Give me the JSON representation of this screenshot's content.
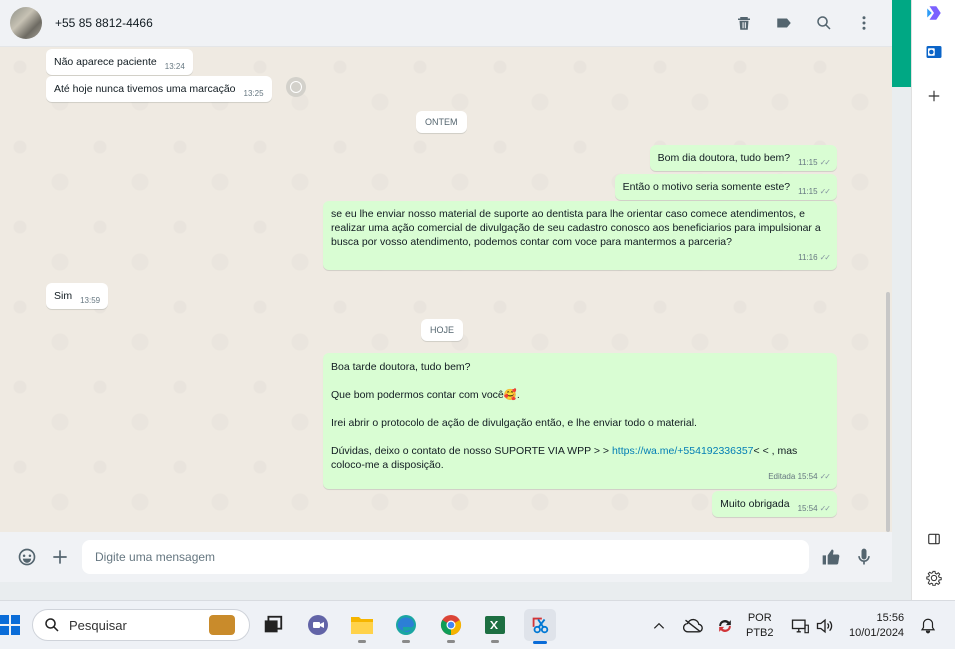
{
  "header": {
    "contact_name": "+55 85 8812-4466",
    "icons": [
      "delete-icon",
      "label-icon",
      "search-icon",
      "menu-icon"
    ]
  },
  "messages": [
    {
      "dir": "in",
      "text": "Não aparece paciente",
      "time": "13:24"
    },
    {
      "dir": "in",
      "text": "Até hoje nunca tivemos uma marcação",
      "time": "13:25"
    },
    {
      "dir": "date",
      "text": "ONTEM"
    },
    {
      "dir": "out",
      "text": "Bom dia doutora, tudo bem?",
      "time": "11:15"
    },
    {
      "dir": "out",
      "text": "Então o motivo seria somente este?",
      "time": "11:15"
    },
    {
      "dir": "out",
      "text": "se eu lhe enviar nosso material de suporte ao dentista para lhe orientar caso comece atendimentos, e realizar uma ação comercial de divulgação de seu cadastro conosco aos beneficiarios para impulsionar a busca por vosso atendimento, podemos contar com voce para mantermos a parceria?",
      "time": "11:16"
    },
    {
      "dir": "in",
      "text": "Sim",
      "time": "13:59"
    },
    {
      "dir": "date",
      "text": "HOJE"
    },
    {
      "dir": "out",
      "line1": "Boa tarde doutora, tudo bem?",
      "line2": "Que bom podermos contar com você🥰.",
      "line3": "Irei abrir o protocolo de ação de divulgação então, e lhe enviar todo o material.",
      "line4_pre": "Dúvidas, deixo o contato de nosso SUPORTE VIA WPP > > ",
      "line4_link": "https://wa.me/+554192336357",
      "line4_post": "< < , mas coloco-me a disposição.",
      "edited": "Editada",
      "time": "15:54"
    },
    {
      "dir": "out",
      "text": "Muito obrigada",
      "time": "15:54"
    }
  ],
  "composer": {
    "placeholder": "Digite uma mensagem"
  },
  "taskbar": {
    "search_placeholder": "Pesquisar",
    "lang_top": "POR",
    "lang_bottom": "PTB2",
    "time": "15:56",
    "date": "10/01/2024"
  },
  "colors": {
    "outgoing_bubble": "#d9fdd3",
    "incoming_bubble": "#ffffff",
    "accent": "#00a884",
    "link": "#027eb5"
  }
}
